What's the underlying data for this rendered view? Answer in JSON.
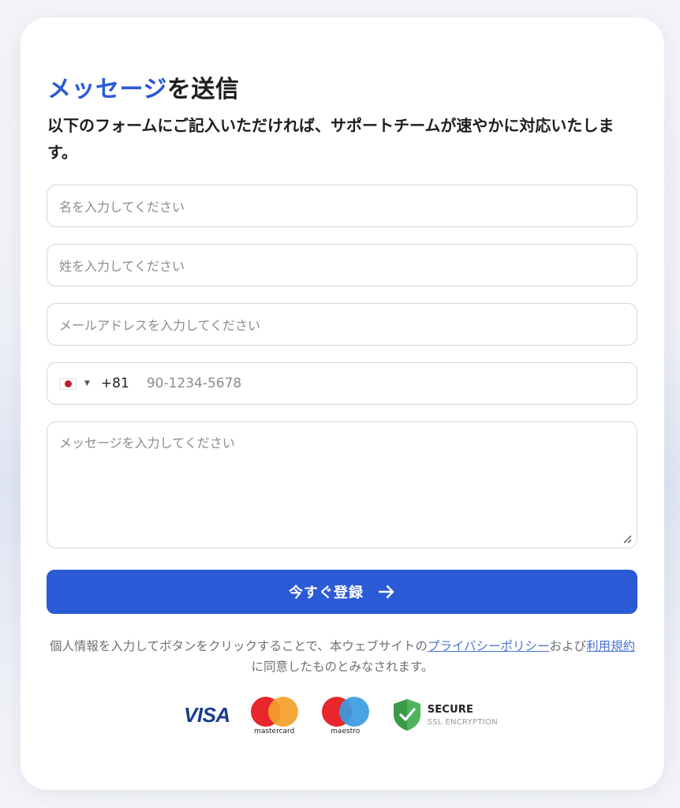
{
  "form": {
    "title_accent": "メッセージ",
    "title_rest": "を送信",
    "subtitle": "以下のフォームにご記入いただければ、サポートチームが速やかに対応いたします。",
    "first_name_placeholder": "名を入力してください",
    "last_name_placeholder": "姓を入力してください",
    "email_placeholder": "メールアドレスを入力してください",
    "phone": {
      "country_flag": "japan-flag-icon",
      "country_code": "+81",
      "placeholder": "90-1234-5678"
    },
    "message_placeholder": "メッセージを入力してください",
    "submit_label": "今すぐ登録",
    "accent_color": "#2b5ad6"
  },
  "legal": {
    "text_before": "個人情報を入力してボタンをクリックすることで、本ウェブサイトの",
    "privacy_link": "プライバシーポリシー",
    "text_middle": "および",
    "terms_link": "利用規約",
    "text_after": "に同意したものとみなされます。"
  },
  "badges": {
    "visa": "VISA",
    "mastercard": "mastercard",
    "maestro": "maestro",
    "secure_title": "SECURE",
    "secure_subtitle": "SSL ENCRYPTION"
  }
}
